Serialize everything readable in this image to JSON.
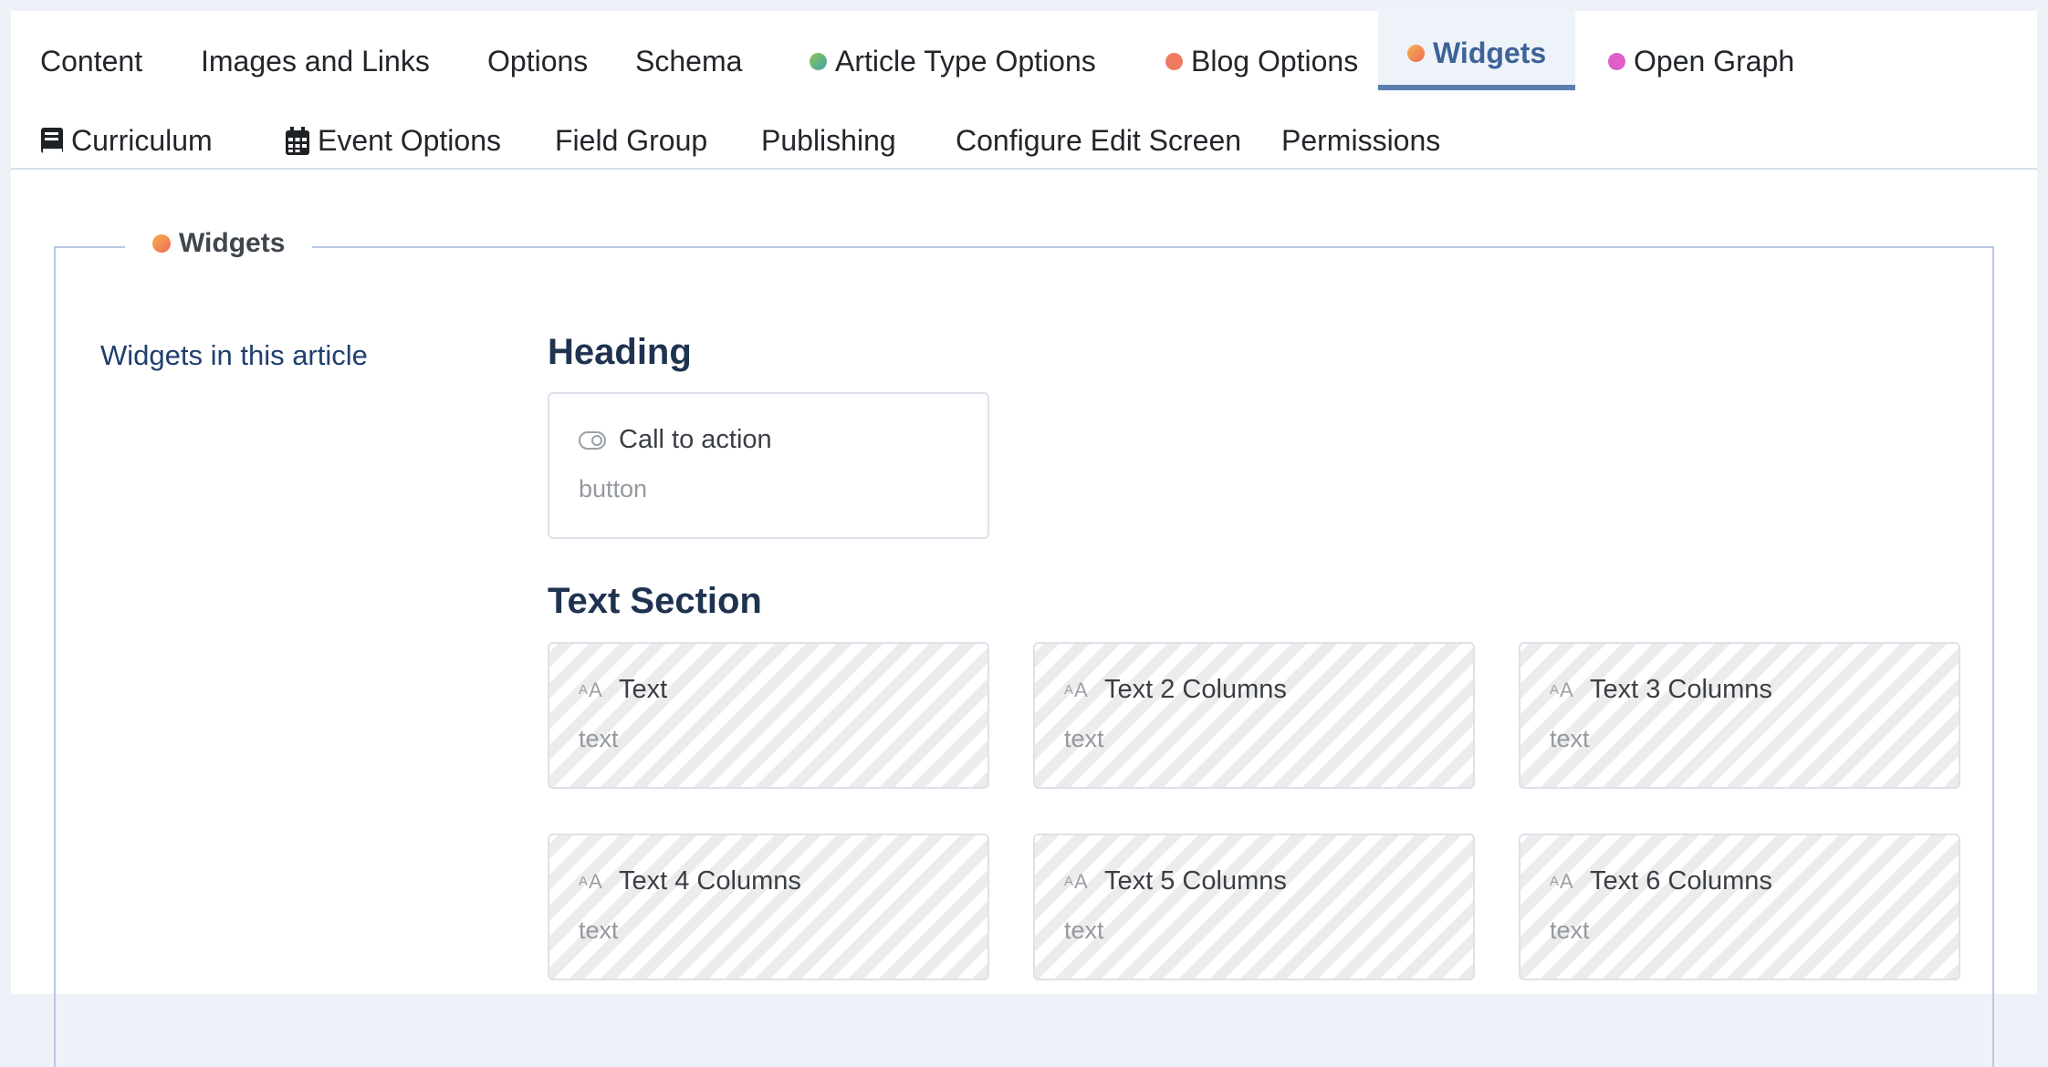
{
  "tabs": {
    "row1": [
      {
        "label": "Content"
      },
      {
        "label": "Images and Links"
      },
      {
        "label": "Options"
      },
      {
        "label": "Schema"
      },
      {
        "label": "Article Type Options"
      },
      {
        "label": "Blog Options"
      },
      {
        "label": "Widgets"
      },
      {
        "label": "Open Graph"
      }
    ],
    "row2": [
      {
        "label": "Curriculum"
      },
      {
        "label": "Event Options"
      },
      {
        "label": "Field Group"
      },
      {
        "label": "Publishing"
      },
      {
        "label": "Configure Edit Screen"
      },
      {
        "label": "Permissions"
      }
    ],
    "active": "Widgets"
  },
  "colors": {
    "dot_article_type": "#5fb58a",
    "dot_blog": "#ee7a62",
    "dot_widgets": "#f18a54",
    "dot_open_graph": "#e05fc8",
    "active_tab": "#5b7eae"
  },
  "icons": {
    "curriculum": "book-icon",
    "event_options": "calendar-icon",
    "call_to_action": "toggle-icon",
    "text": "font-size-icon"
  },
  "fieldset": {
    "legend": "Widgets",
    "side_label": "Widgets in this article"
  },
  "sections": {
    "heading": {
      "title": "Heading",
      "cards": [
        {
          "title": "Call to action",
          "type": "button"
        }
      ]
    },
    "text_section": {
      "title": "Text Section",
      "cards": [
        {
          "title": "Text",
          "type": "text"
        },
        {
          "title": "Text 2 Columns",
          "type": "text"
        },
        {
          "title": "Text 3 Columns",
          "type": "text"
        },
        {
          "title": "Text 4 Columns",
          "type": "text"
        },
        {
          "title": "Text 5 Columns",
          "type": "text"
        },
        {
          "title": "Text 6 Columns",
          "type": "text"
        }
      ]
    }
  }
}
